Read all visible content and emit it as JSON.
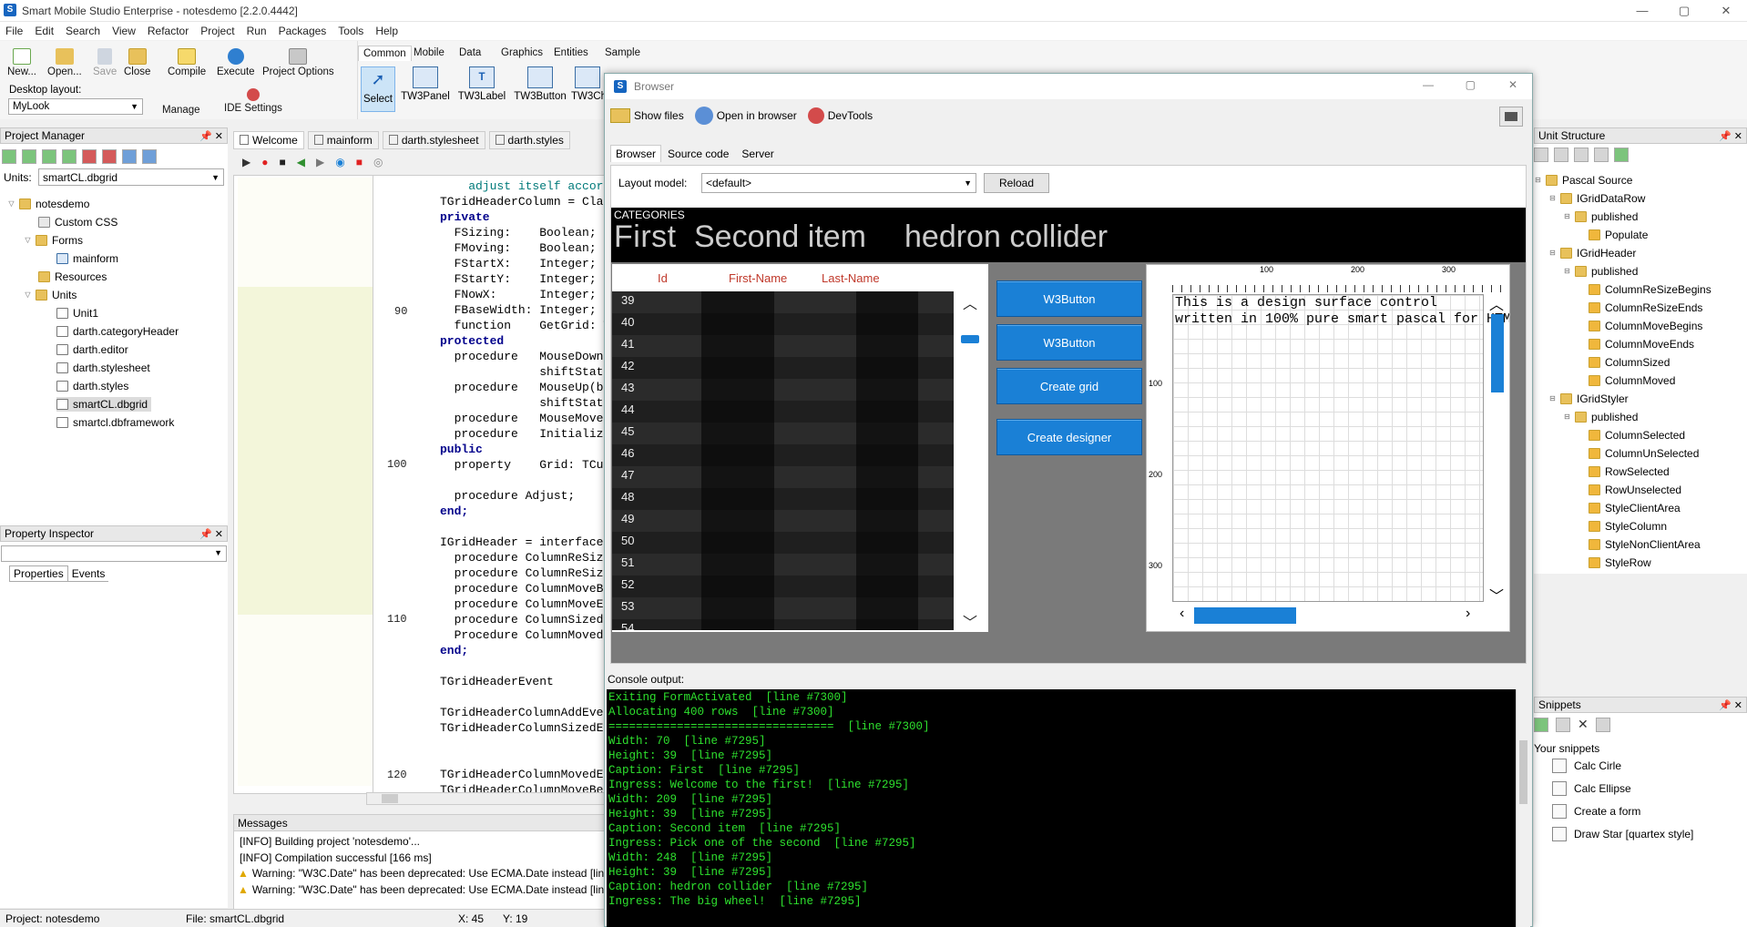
{
  "app": {
    "title": "Smart Mobile Studio Enterprise - notesdemo [2.2.0.4442]",
    "icon": "S",
    "minimize": "—",
    "maximize": "▢",
    "close": "✕"
  },
  "menu": [
    "File",
    "Edit",
    "Search",
    "View",
    "Refactor",
    "Project",
    "Run",
    "Packages",
    "Tools",
    "Help"
  ],
  "toolbar": {
    "new": "New...",
    "open": "Open...",
    "save": "Save",
    "close": "Close",
    "compile": "Compile",
    "execute": "Execute",
    "project_options": "Project Options",
    "desktop_layout_label": "Desktop layout:",
    "layout_value": "MyLook",
    "manage": "Manage",
    "ide_settings": "IDE Settings"
  },
  "palette": {
    "tabs": [
      "Common",
      "Mobile",
      "Data",
      "Graphics",
      "Entities",
      "Sample"
    ],
    "active_tab": "Common",
    "items": [
      "Select",
      "TW3Panel",
      "TW3Label",
      "TW3Button",
      "TW3Ch"
    ]
  },
  "project_manager": {
    "title": "Project Manager",
    "pin": "🖈",
    "close": "✕",
    "units_label": "Units:",
    "units_value": "smartCL.dbgrid",
    "tree": [
      "notesdemo",
      "Custom CSS",
      "Forms",
      "mainform",
      "Resources",
      "Units",
      "Unit1",
      "darth.categoryHeader",
      "darth.editor",
      "darth.stylesheet",
      "darth.styles",
      "smartCL.dbgrid",
      "smartcl.dbframework"
    ]
  },
  "property_inspector": {
    "title": "Property Inspector",
    "tabs": [
      "Properties",
      "Events"
    ]
  },
  "editor": {
    "tabs": [
      "Welcome",
      "mainform",
      "darth.stylesheet",
      "darth.styles"
    ],
    "line_numbers": [
      "90",
      "100",
      "110",
      "120"
    ],
    "code_lines": [
      "    adjust itself accor",
      "TGridHeaderColumn = Clas",
      "private",
      "  FSizing:    Boolean;",
      "  FMoving:    Boolean;",
      "  FStartX:    Integer;",
      "  FStartY:    Integer;",
      "  FNowX:      Integer;",
      "  FBaseWidth: Integer;",
      "  function    GetGrid: T",
      "protected",
      "  procedure   MouseDown",
      "              shiftState",
      "  procedure   MouseUp(bu",
      "              shiftState",
      "  procedure   MouseMove",
      "  procedure   Initialize",
      "public",
      "  property    Grid: TCus",
      "",
      "  procedure Adjust;",
      "end;",
      "",
      "IGridHeader = interface",
      "  procedure ColumnReSize",
      "  procedure ColumnReSize",
      "  procedure ColumnMoveBe",
      "  procedure ColumnMoveEn",
      "  procedure ColumnSized(",
      "  Procedure ColumnMoved(",
      "end;",
      "",
      "TGridHeaderEvent",
      "",
      "TGridHeaderColumnAddEve",
      "TGridHeaderColumnSizedEv",
      "",
      "",
      "TGridHeaderColumnMovedEv",
      "TGridHeaderColumnMoveBeg"
    ]
  },
  "messages": {
    "title": "Messages",
    "lines": [
      "[INFO] Building project 'notesdemo'...",
      "[INFO] Compilation successful [166 ms]",
      "Warning: \"W3C.Date\" has been deprecated: Use ECMA.Date instead [line",
      "Warning: \"W3C.Date\" has been deprecated: Use ECMA.Date instead [line"
    ]
  },
  "statusbar": {
    "project": "Project: notesdemo",
    "file": "File: smartCL.dbgrid",
    "x": "X: 45",
    "y": "Y: 19"
  },
  "browser": {
    "title": "Browser",
    "toolbar": {
      "show_files": "Show files",
      "open_in_browser": "Open in browser",
      "devtools": "DevTools"
    },
    "tabs": [
      "Browser",
      "Source code",
      "Server"
    ],
    "layout_label": "Layout model:",
    "layout_value": "<default>",
    "reload": "Reload",
    "categories_label": "CATEGORIES",
    "categories": [
      "First",
      "Second item",
      "hedron collider"
    ],
    "grid": {
      "headers": [
        "Id",
        "First-Name",
        "Last-Name"
      ],
      "rows": [
        "39",
        "40",
        "41",
        "42",
        "43",
        "44",
        "45",
        "46",
        "47",
        "48",
        "49",
        "50",
        "51",
        "52",
        "53",
        "54"
      ]
    },
    "buttons": [
      "W3Button",
      "W3Button",
      "Create grid",
      "Create designer"
    ],
    "designer": {
      "ruler_top": [
        "100",
        "200",
        "300"
      ],
      "ruler_left": [
        "100",
        "200",
        "300"
      ],
      "text_line1": "This is a design surface control",
      "text_line2": "written in 100% pure smart pascal for HTM"
    },
    "console_label": "Console output:",
    "console_lines": [
      "Exiting FormActivated  [line #7300]",
      "Allocating 400 rows  [line #7300]",
      "=================================  [line #7300]",
      "Width: 70  [line #7295]",
      "Height: 39  [line #7295]",
      "Caption: First  [line #7295]",
      "Ingress: Welcome to the first!  [line #7295]",
      "Width: 209  [line #7295]",
      "Height: 39  [line #7295]",
      "Caption: Second item  [line #7295]",
      "Ingress: Pick one of the second  [line #7295]",
      "Width: 248  [line #7295]",
      "Height: 39  [line #7295]",
      "Caption: hedron collider  [line #7295]",
      "Ingress: The big wheel!  [line #7295]"
    ]
  },
  "unit_structure": {
    "title": "Unit Structure",
    "tree": [
      "Pascal Source",
      "IGridDataRow",
      "published",
      "Populate",
      "IGridHeader",
      "published",
      "ColumnReSizeBegins",
      "ColumnReSizeEnds",
      "ColumnMoveBegins",
      "ColumnMoveEnds",
      "ColumnSized",
      "ColumnMoved",
      "IGridStyler",
      "published",
      "ColumnSelected",
      "ColumnUnSelected",
      "RowSelected",
      "RowUnselected",
      "StyleClientArea",
      "StyleColumn",
      "StyleNonClientArea",
      "StyleRow"
    ]
  },
  "snippets": {
    "title": "Snippets",
    "subtitle": "Your snippets",
    "items": [
      "Calc Cirle",
      "Calc Ellipse",
      "Create a form",
      "Draw Star [quartex style]"
    ]
  },
  "colors": {
    "accent": "#1a80d6",
    "console_text": "#2ee02e",
    "console_bg": "#000000",
    "grid_header_text": "#c0392b",
    "keyword": "#00008b"
  }
}
